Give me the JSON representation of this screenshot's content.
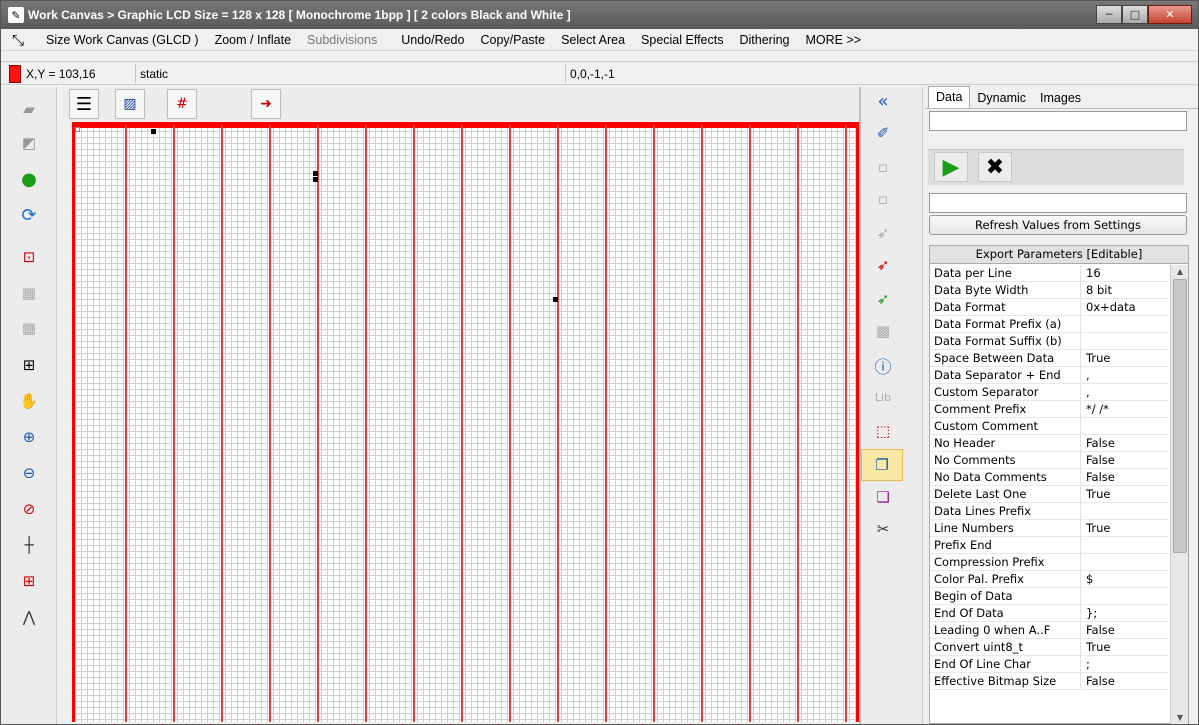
{
  "window": {
    "title": "Work Canvas > Graphic LCD Size = 128 x 128 [ Monochrome 1bpp ] [ 2 colors Black and White ]",
    "minimize": "─",
    "maximize": "□",
    "close": "✕"
  },
  "menu": {
    "items": [
      {
        "label": "Size Work Canvas (GLCD )",
        "enabled": true
      },
      {
        "label": "Zoom / Inflate",
        "enabled": true
      },
      {
        "label": "Subdivisions",
        "enabled": false
      },
      {
        "label": "Undo/Redo",
        "enabled": true
      },
      {
        "label": "Copy/Paste",
        "enabled": true
      },
      {
        "label": "Select Area",
        "enabled": true
      },
      {
        "label": "Special Effects",
        "enabled": true
      },
      {
        "label": "Dithering",
        "enabled": true
      },
      {
        "label": "MORE >>",
        "enabled": true
      }
    ]
  },
  "status": {
    "coords": "X,Y = 103,16",
    "mode": "static",
    "rect": "0,0,-1,-1",
    "color": "#ff1414"
  },
  "canvas_toolbar": {
    "icons": [
      "menu-icon",
      "clear-canvas-icon",
      "grid-hash-icon",
      "export-icon"
    ]
  },
  "right_panel": {
    "tabs": [
      "Data",
      "Dynamic",
      "Images"
    ],
    "active_tab": "Data",
    "refresh_label": "Refresh Values from Settings",
    "grid_header": "Export Parameters [Editable]",
    "properties": [
      {
        "name": "Data per Line",
        "value": "16"
      },
      {
        "name": "Data Byte Width",
        "value": "8 bit"
      },
      {
        "name": "Data Format",
        "value": "0x+data"
      },
      {
        "name": "Data Format Prefix (a)",
        "value": ""
      },
      {
        "name": "Data Format Suffix (b)",
        "value": ""
      },
      {
        "name": "Space Between Data",
        "value": "True"
      },
      {
        "name": "Data Separator + End",
        "value": ","
      },
      {
        "name": "Custom Separator",
        "value": ","
      },
      {
        "name": "Comment Prefix",
        "value": "*/ /*"
      },
      {
        "name": "Custom Comment",
        "value": ""
      },
      {
        "name": "No Header",
        "value": "False"
      },
      {
        "name": "No Comments",
        "value": "False"
      },
      {
        "name": "No Data Comments",
        "value": "False"
      },
      {
        "name": "Delete Last One",
        "value": "True"
      },
      {
        "name": "Data Lines Prefix",
        "value": ""
      },
      {
        "name": "Line Numbers",
        "value": "True"
      },
      {
        "name": "Prefix End",
        "value": ""
      },
      {
        "name": "Compression Prefix",
        "value": ""
      },
      {
        "name": "Color Pal. Prefix",
        "value": "$"
      },
      {
        "name": "Begin of Data",
        "value": ""
      },
      {
        "name": "End Of Data",
        "value": "};"
      },
      {
        "name": "Leading 0 when A..F",
        "value": "False"
      },
      {
        "name": "Convert uint8_t",
        "value": "True"
      },
      {
        "name": "End Of Line Char",
        "value": ";"
      },
      {
        "name": "Effective Bitmap Size",
        "value": "False"
      }
    ]
  }
}
